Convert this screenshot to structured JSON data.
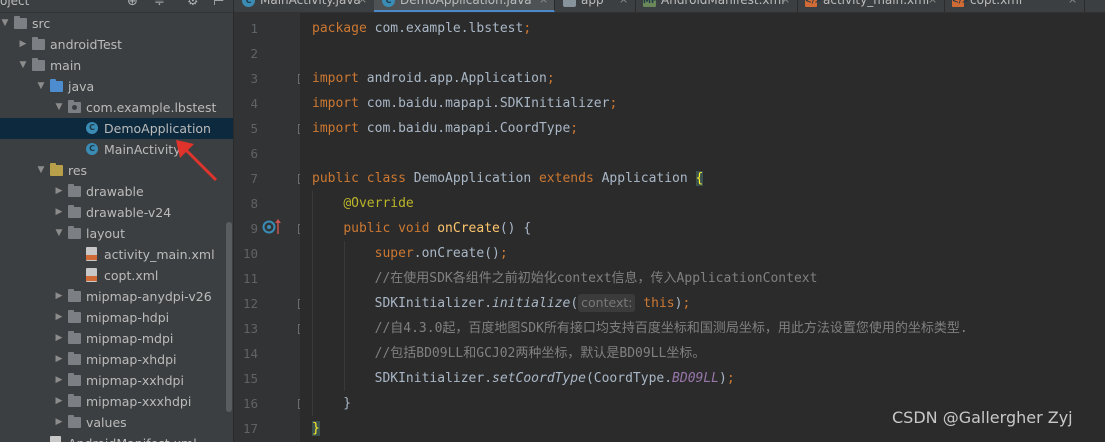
{
  "project_panel": {
    "title": "oject",
    "toolbar_icons": [
      "add-icon",
      "collapse-icon",
      "gear-icon",
      "hide-icon"
    ],
    "tree": [
      {
        "label": "src",
        "icon": "folder-icon",
        "arrow": "▼",
        "level": 0
      },
      {
        "label": "androidTest",
        "icon": "folder-icon",
        "arrow": "▶",
        "level": 1
      },
      {
        "label": "main",
        "icon": "folder-icon",
        "arrow": "▼",
        "level": 1
      },
      {
        "label": "java",
        "icon": "java-folder-icon",
        "arrow": "▼",
        "level": 2
      },
      {
        "label": "com.example.lbstest",
        "icon": "package-icon",
        "arrow": "▼",
        "level": 3
      },
      {
        "label": "DemoApplication",
        "icon": "class-icon",
        "arrow": "",
        "level": 4,
        "selected": true
      },
      {
        "label": "MainActivity",
        "icon": "class-icon",
        "arrow": "",
        "level": 4
      },
      {
        "label": "res",
        "icon": "res-folder-icon",
        "arrow": "▼",
        "level": 2
      },
      {
        "label": "drawable",
        "icon": "folder-icon",
        "arrow": "▶",
        "level": 3
      },
      {
        "label": "drawable-v24",
        "icon": "folder-icon",
        "arrow": "▶",
        "level": 3
      },
      {
        "label": "layout",
        "icon": "folder-icon",
        "arrow": "▼",
        "level": 3
      },
      {
        "label": "activity_main.xml",
        "icon": "xml-file-icon",
        "arrow": "",
        "level": 4
      },
      {
        "label": "copt.xml",
        "icon": "xml-file-icon",
        "arrow": "",
        "level": 4
      },
      {
        "label": "mipmap-anydpi-v26",
        "icon": "folder-icon",
        "arrow": "▶",
        "level": 3
      },
      {
        "label": "mipmap-hdpi",
        "icon": "folder-icon",
        "arrow": "▶",
        "level": 3
      },
      {
        "label": "mipmap-mdpi",
        "icon": "folder-icon",
        "arrow": "▶",
        "level": 3
      },
      {
        "label": "mipmap-xhdpi",
        "icon": "folder-icon",
        "arrow": "▶",
        "level": 3
      },
      {
        "label": "mipmap-xxhdpi",
        "icon": "folder-icon",
        "arrow": "▶",
        "level": 3
      },
      {
        "label": "mipmap-xxxhdpi",
        "icon": "folder-icon",
        "arrow": "▶",
        "level": 3
      },
      {
        "label": "values",
        "icon": "folder-icon",
        "arrow": "▶",
        "level": 3
      },
      {
        "label": "AndroidManifest.xml",
        "icon": "manifest-icon",
        "arrow": "",
        "level": 2
      }
    ]
  },
  "tabs": [
    {
      "label": "MainActivity.java",
      "icon": "class-icon",
      "glyph": "C"
    },
    {
      "label": "DemoApplication.java",
      "icon": "class-icon",
      "glyph": "C",
      "active": true
    },
    {
      "label": "app",
      "icon": "app-module-icon",
      "glyph": ""
    },
    {
      "label": "AndroidManifest.xml",
      "icon": "manifest-icon",
      "glyph": "MF"
    },
    {
      "label": "activity_main.xml",
      "icon": "xml-file-icon",
      "glyph": "</>"
    },
    {
      "label": "copt.xml",
      "icon": "xml-file-icon",
      "glyph": "</>"
    }
  ],
  "editor": {
    "line_numbers": [
      "1",
      "2",
      "3",
      "4",
      "5",
      "6",
      "7",
      "8",
      "9",
      "10",
      "11",
      "12",
      "13",
      "14",
      "15",
      "16",
      "17"
    ],
    "lines": [
      [
        {
          "t": "package ",
          "c": "kw"
        },
        {
          "t": "com.example.lbstest",
          "c": ""
        },
        {
          "t": ";",
          "c": "kw"
        }
      ],
      [],
      [
        {
          "t": "import ",
          "c": "kw"
        },
        {
          "t": "android.app.Application",
          "c": ""
        },
        {
          "t": ";",
          "c": "kw"
        }
      ],
      [
        {
          "t": "import ",
          "c": "kw"
        },
        {
          "t": "com.baidu.mapapi.SDKInitializer",
          "c": ""
        },
        {
          "t": ";",
          "c": "kw"
        }
      ],
      [
        {
          "t": "import ",
          "c": "kw"
        },
        {
          "t": "com.baidu.mapapi.CoordType",
          "c": ""
        },
        {
          "t": ";",
          "c": "kw"
        }
      ],
      [],
      [
        {
          "t": "public class ",
          "c": "kw"
        },
        {
          "t": "DemoApplication ",
          "c": ""
        },
        {
          "t": "extends ",
          "c": "kw"
        },
        {
          "t": "Application ",
          "c": ""
        },
        {
          "t": "{",
          "c": "brace-hl"
        }
      ],
      [
        {
          "t": "    ",
          "c": ""
        },
        {
          "t": "@Override",
          "c": "ann"
        }
      ],
      [
        {
          "t": "    ",
          "c": ""
        },
        {
          "t": "public void ",
          "c": "kw"
        },
        {
          "t": "onCreate",
          "c": "fn"
        },
        {
          "t": "() {",
          "c": ""
        }
      ],
      [
        {
          "t": "        ",
          "c": ""
        },
        {
          "t": "super",
          "c": "kw"
        },
        {
          "t": ".onCreate()",
          "c": ""
        },
        {
          "t": ";",
          "c": "kw"
        }
      ],
      [
        {
          "t": "        ",
          "c": ""
        },
        {
          "t": "//在使用SDK各组件之前初始化context信息，传入ApplicationContext",
          "c": "cmt"
        }
      ],
      [
        {
          "t": "        ",
          "c": ""
        },
        {
          "t": "SDKInitializer.",
          "c": ""
        },
        {
          "t": "initialize",
          "c": "italic"
        },
        {
          "t": "(",
          "c": ""
        },
        {
          "t": "context:",
          "c": "param-hint"
        },
        {
          "t": " ",
          "c": ""
        },
        {
          "t": "this",
          "c": "kw"
        },
        {
          "t": ")",
          "c": ""
        },
        {
          "t": ";",
          "c": "kw"
        }
      ],
      [
        {
          "t": "        ",
          "c": ""
        },
        {
          "t": "//自4.3.0起，百度地图SDK所有接口均支持百度坐标和国测局坐标，用此方法设置您使用的坐标类型.",
          "c": "cmt"
        }
      ],
      [
        {
          "t": "        ",
          "c": ""
        },
        {
          "t": "//包括BD09LL和GCJ02两种坐标，默认是BD09LL坐标。",
          "c": "cmt"
        }
      ],
      [
        {
          "t": "        ",
          "c": ""
        },
        {
          "t": "SDKInitializer.",
          "c": ""
        },
        {
          "t": "setCoordType",
          "c": "italic"
        },
        {
          "t": "(CoordType.",
          "c": ""
        },
        {
          "t": "BD09LL",
          "c": "const"
        },
        {
          "t": ")",
          "c": ""
        },
        {
          "t": ";",
          "c": "kw"
        }
      ],
      [
        {
          "t": "    }",
          "c": ""
        }
      ],
      [
        {
          "t": "}",
          "c": "brace-hl"
        }
      ]
    ]
  },
  "watermark": "CSDN @Gallergher Zyj",
  "colors": {
    "background": "#2b2b2b",
    "keyword": "#cc7832",
    "annotation": "#bbb529",
    "method": "#ffc66d",
    "comment": "#808080",
    "constant": "#9876aa",
    "selection": "#0d293e",
    "red_arrow": "#e0332b"
  }
}
